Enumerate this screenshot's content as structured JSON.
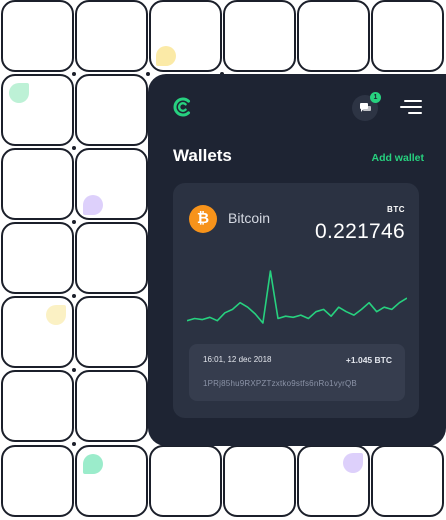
{
  "header": {
    "logo_icon": "coin-logo-icon",
    "notification_count": "1",
    "menu_icon": "hamburger-menu-icon"
  },
  "page": {
    "title": "Wallets",
    "add_wallet_label": "Add wallet"
  },
  "wallet": {
    "coin_name": "Bitcoin",
    "coin_symbol": "₿",
    "ticker": "BTC",
    "balance": "0.221746",
    "price_history": [
      4,
      6,
      5,
      7,
      4,
      11,
      14,
      20,
      16,
      10,
      2,
      48,
      6,
      8,
      7,
      9,
      6,
      12,
      14,
      8,
      16,
      12,
      9,
      14,
      20,
      12,
      16,
      14,
      20,
      24
    ]
  },
  "transaction": {
    "date": "16:01, 12 dec 2018",
    "amount": "+1.045 BTC",
    "address": "1PRj85hu9RXPZTzxtko9stfs6nRo1vyrQB"
  },
  "colors": {
    "accent": "#27d17f",
    "panel": "#1e2433",
    "card": "#2b3242",
    "bitcoin": "#f7931a"
  }
}
